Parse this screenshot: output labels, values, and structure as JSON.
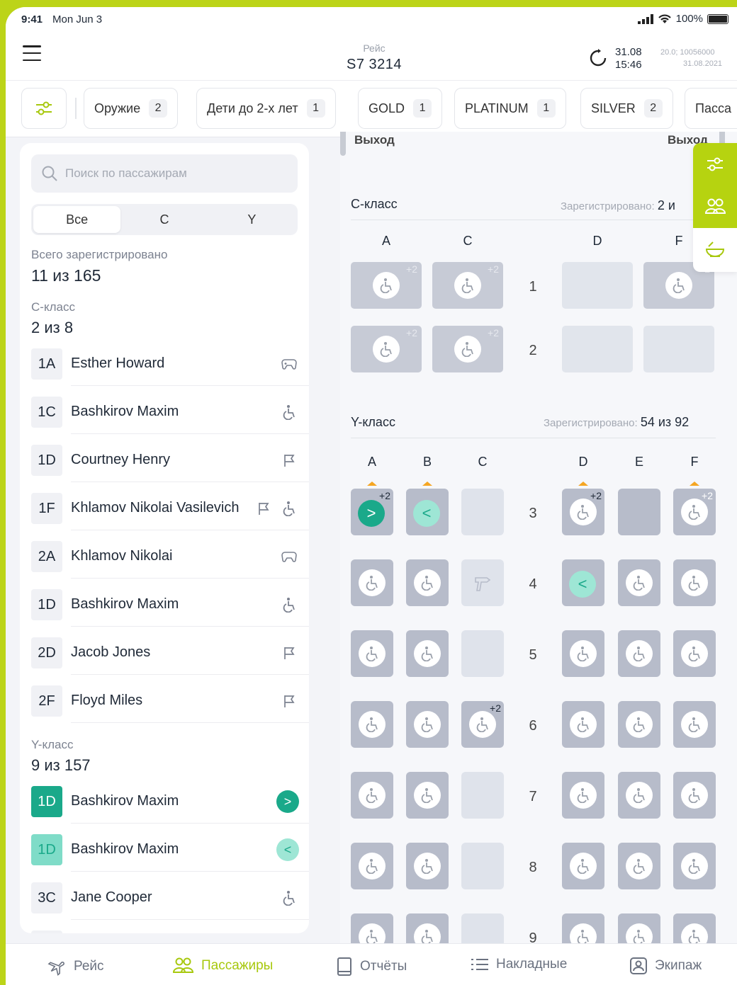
{
  "status_bar": {
    "time": "9:41",
    "date": "Mon Jun 3",
    "battery": "100%"
  },
  "header": {
    "flight_label": "Рейс",
    "flight_number": "S7 3214",
    "sync_date": "31.08",
    "sync_time": "15:46",
    "meta_version": "20.0; 10056000",
    "meta_date": "31.08.2021"
  },
  "filters": {
    "chips": [
      {
        "label": "Оружие",
        "count": "2"
      },
      {
        "label": "Дети до 2-х лет",
        "count": "1"
      },
      {
        "label": "GOLD",
        "count": "1"
      },
      {
        "label": "PLATINUM",
        "count": "1"
      },
      {
        "label": "SILVER",
        "count": "2"
      },
      {
        "label": "Пасса"
      }
    ]
  },
  "left_panel": {
    "search_placeholder": "Поиск по пассажирам",
    "segments": [
      "Все",
      "C",
      "Y"
    ],
    "total_label": "Всего зарегистрировано",
    "total_value": "11 из 165",
    "c_class_label": "С-класс",
    "c_class_value": "2 из 8",
    "c_passengers": [
      {
        "seat": "1A",
        "name": "Esther Howard",
        "icon": "gamepad-icon"
      },
      {
        "seat": "1C",
        "name": "Bashkirov Maxim",
        "icon": "wheelchair-icon"
      },
      {
        "seat": "1D",
        "name": "Courtney Henry",
        "icon": "flag-icon"
      },
      {
        "seat": "1F",
        "name": "Khlamov Nikolai Vasilevich",
        "icon": "flag-wheelchair-icon"
      },
      {
        "seat": "2A",
        "name": "Khlamov Nikolai",
        "icon": "gamepad-icon"
      },
      {
        "seat": "1D",
        "name": "Bashkirov Maxim",
        "icon": "wheelchair-icon"
      },
      {
        "seat": "2D",
        "name": "Jacob Jones",
        "icon": "flag-icon"
      },
      {
        "seat": "2F",
        "name": "Floyd Miles",
        "icon": "flag-icon"
      }
    ],
    "y_class_label": "Y-класс",
    "y_class_value": "9 из 157",
    "y_passengers": [
      {
        "seat": "1D",
        "name": "Bashkirov Maxim",
        "icon": ">"
      },
      {
        "seat": "1D",
        "name": "Bashkirov Maxim",
        "icon": "<"
      },
      {
        "seat": "3C",
        "name": "Jane Cooper",
        "icon": "wheelchair-icon"
      }
    ]
  },
  "seat_map": {
    "exit_left": "Выход",
    "exit_right": "Выход",
    "c_class": {
      "title": "С-класс",
      "registered_label": "Зарегистрировано:",
      "registered_value": "2 и",
      "columns": [
        "A",
        "C",
        "D",
        "F"
      ],
      "rows": [
        "1",
        "2"
      ],
      "badge": "+2"
    },
    "y_class": {
      "title": "Y-класс",
      "registered_label": "Зарегистрировано:",
      "registered_value": "54 из 92",
      "columns": [
        "A",
        "B",
        "C",
        "D",
        "E",
        "F"
      ],
      "rows": [
        "3",
        "4",
        "5",
        "6",
        "7",
        "8",
        "9"
      ],
      "badge": "+2",
      "arrow_right": ">",
      "arrow_left": "<"
    }
  },
  "tabbar": {
    "tabs": [
      {
        "label": "Рейс",
        "icon": "plane-icon"
      },
      {
        "label": "Пассажиры",
        "icon": "users-icon",
        "active": true
      },
      {
        "label": "Отчёты",
        "icon": "tablet-icon"
      },
      {
        "label": "Накладные",
        "icon": "list-icon"
      },
      {
        "label": "Экипаж",
        "icon": "id-badge-icon"
      }
    ]
  },
  "colors": {
    "accent": "#b6d310",
    "teal": "#1aa98a",
    "teal_light": "#9ee6d5"
  }
}
